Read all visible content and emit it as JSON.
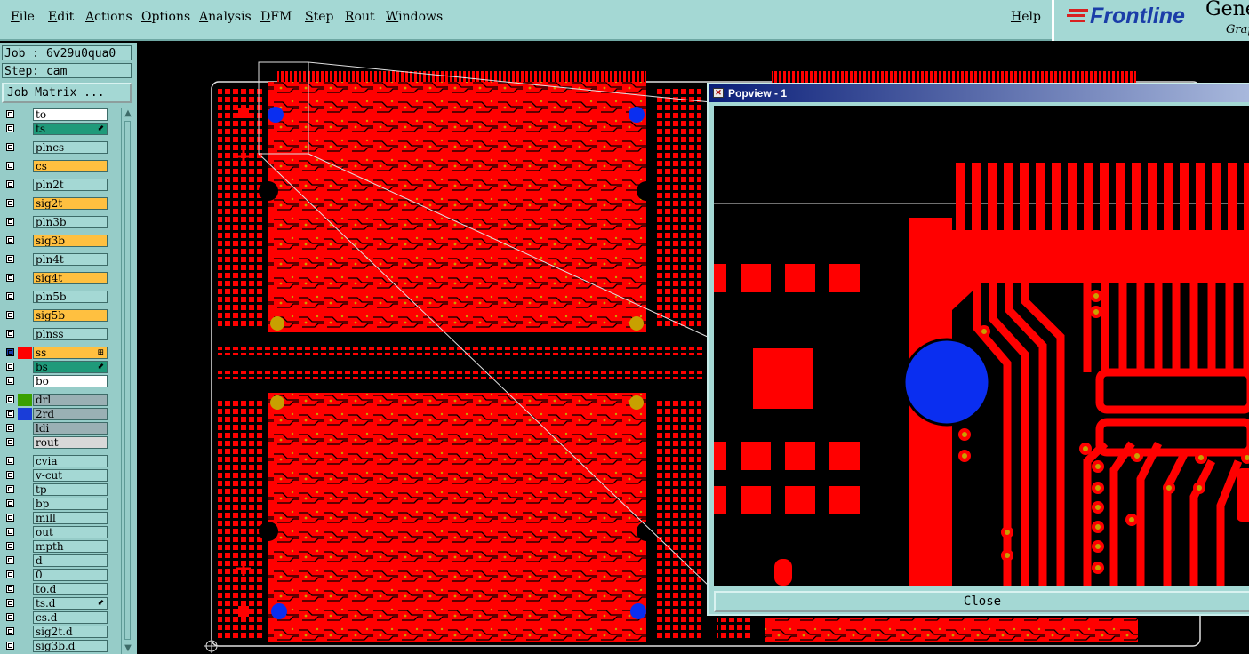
{
  "menubar": {
    "items": [
      {
        "label": "File"
      },
      {
        "label": "Edit"
      },
      {
        "label": "Actions"
      },
      {
        "label": "Options"
      },
      {
        "label": "Analysis"
      },
      {
        "label": "DFM"
      },
      {
        "label": "Step"
      },
      {
        "label": "Rout"
      },
      {
        "label": "Windows"
      }
    ],
    "help": "Help"
  },
  "logo": {
    "brand": "Frontline",
    "product": "Gene",
    "product_sub": "Grap"
  },
  "job_info": {
    "job": "Job : 6v29u0qua0",
    "step": "Step: cam"
  },
  "job_matrix_button": "Job Matrix ...",
  "layers": [
    {
      "name": "to",
      "color": "#ffffff",
      "swatch": "",
      "selected": false
    },
    {
      "name": "ts",
      "color": "#1f9a7a",
      "swatch": "",
      "selected": false,
      "mark": "⬋"
    },
    {
      "name": "plncs",
      "color": "#a4d8d4",
      "swatch": "",
      "selected": false
    },
    {
      "name": "cs",
      "color": "#ffc040",
      "swatch": "",
      "selected": false
    },
    {
      "name": "pln2t",
      "color": "#a4d8d4",
      "swatch": "",
      "selected": false
    },
    {
      "name": "sig2t",
      "color": "#ffc040",
      "swatch": "",
      "selected": false
    },
    {
      "name": "pln3b",
      "color": "#a4d8d4",
      "swatch": "",
      "selected": false
    },
    {
      "name": "sig3b",
      "color": "#ffc040",
      "swatch": "",
      "selected": false
    },
    {
      "name": "pln4t",
      "color": "#a4d8d4",
      "swatch": "",
      "selected": false
    },
    {
      "name": "sig4t",
      "color": "#ffc040",
      "swatch": "",
      "selected": false
    },
    {
      "name": "pln5b",
      "color": "#a4d8d4",
      "swatch": "",
      "selected": false
    },
    {
      "name": "sig5b",
      "color": "#ffc040",
      "swatch": "",
      "selected": false
    },
    {
      "name": "plnss",
      "color": "#a4d8d4",
      "swatch": "",
      "selected": false
    },
    {
      "name": "ss",
      "color": "#ffc040",
      "swatch": "#ff0000",
      "selected": true,
      "mark": "⊞"
    },
    {
      "name": "bs",
      "color": "#1f9a7a",
      "swatch": "",
      "selected": false,
      "mark": "⬋"
    },
    {
      "name": "bo",
      "color": "#ffffff",
      "swatch": "",
      "selected": false
    },
    {
      "name": "drl",
      "color": "#9ab0b4",
      "swatch": "#3aa000",
      "selected": false
    },
    {
      "name": "2rd",
      "color": "#9ab0b4",
      "swatch": "#1a3dd8",
      "selected": false
    },
    {
      "name": "ldi",
      "color": "#9ab0b4",
      "swatch": "",
      "selected": false
    },
    {
      "name": "rout",
      "color": "#d8d8d8",
      "swatch": "",
      "selected": false
    },
    {
      "name": "cvia",
      "color": "#a4d8d4",
      "swatch": "",
      "selected": false
    },
    {
      "name": "v-cut",
      "color": "#a4d8d4",
      "swatch": "",
      "selected": false
    },
    {
      "name": "tp",
      "color": "#a4d8d4",
      "swatch": "",
      "selected": false
    },
    {
      "name": "bp",
      "color": "#a4d8d4",
      "swatch": "",
      "selected": false
    },
    {
      "name": "mill",
      "color": "#a4d8d4",
      "swatch": "",
      "selected": false
    },
    {
      "name": "out",
      "color": "#a4d8d4",
      "swatch": "",
      "selected": false
    },
    {
      "name": "mpth",
      "color": "#a4d8d4",
      "swatch": "",
      "selected": false
    },
    {
      "name": "d",
      "color": "#a4d8d4",
      "swatch": "",
      "selected": false
    },
    {
      "name": "0",
      "color": "#a4d8d4",
      "swatch": "",
      "selected": false
    },
    {
      "name": "to.d",
      "color": "#a4d8d4",
      "swatch": "",
      "selected": false
    },
    {
      "name": "ts.d",
      "color": "#a4d8d4",
      "swatch": "",
      "selected": false,
      "mark": "⬋"
    },
    {
      "name": "cs.d",
      "color": "#a4d8d4",
      "swatch": "",
      "selected": false
    },
    {
      "name": "sig2t.d",
      "color": "#a4d8d4",
      "swatch": "",
      "selected": false
    },
    {
      "name": "sig3b.d",
      "color": "#a4d8d4",
      "swatch": "",
      "selected": false
    }
  ],
  "popview": {
    "title": "Popview - 1",
    "close_label": "Close"
  },
  "colors": {
    "copper": "#ff0000",
    "pad_blue": "#0a2ef0",
    "pad_gold": "#c8a000",
    "panel": "#a4d8d4"
  }
}
